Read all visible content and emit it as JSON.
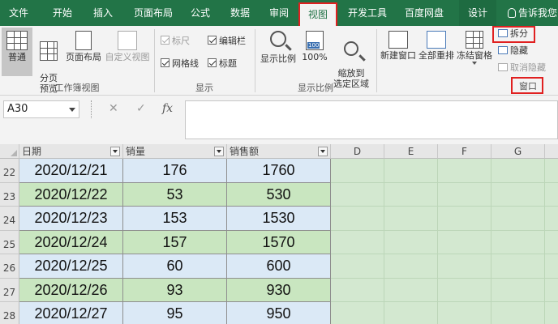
{
  "tabs": [
    "文件",
    "开始",
    "插入",
    "页面布局",
    "公式",
    "数据",
    "审阅",
    "视图",
    "开发工具",
    "百度网盘",
    "设计"
  ],
  "active_tab": "视图",
  "tell_me": "告诉我您",
  "ribbon": {
    "workbook_views": {
      "label": "工作簿视图",
      "buttons": [
        "普通",
        "分页\n预览",
        "页面布局",
        "自定义视图"
      ]
    },
    "show": {
      "label": "显示",
      "checkboxes": [
        {
          "label": "标尺",
          "checked": true,
          "disabled": true
        },
        {
          "label": "编辑栏",
          "checked": true,
          "disabled": false
        },
        {
          "label": "网格线",
          "checked": true,
          "disabled": false
        },
        {
          "label": "标题",
          "checked": true,
          "disabled": false
        }
      ]
    },
    "zoom": {
      "label": "显示比例",
      "buttons": [
        "显示比例",
        "100%",
        "缩放到\n选定区域"
      ],
      "badge": "100"
    },
    "window": {
      "label": "窗口",
      "buttons": [
        "新建窗口",
        "全部重排",
        "冻结窗格"
      ],
      "small": [
        "拆分",
        "隐藏",
        "取消隐藏"
      ]
    }
  },
  "formula_bar": {
    "name_box": "A30",
    "cancel": "✕",
    "enter": "✓",
    "fx": "fx",
    "value": ""
  },
  "grid": {
    "columns": [
      "日期",
      "销量",
      "销售额",
      "D",
      "E",
      "F",
      "G"
    ],
    "rows": [
      {
        "num": "22",
        "date": "2020/12/21",
        "qty": "176",
        "amt": "1760"
      },
      {
        "num": "23",
        "date": "2020/12/22",
        "qty": "53",
        "amt": "530"
      },
      {
        "num": "24",
        "date": "2020/12/23",
        "qty": "153",
        "amt": "1530"
      },
      {
        "num": "25",
        "date": "2020/12/24",
        "qty": "157",
        "amt": "1570"
      },
      {
        "num": "26",
        "date": "2020/12/25",
        "qty": "60",
        "amt": "600"
      },
      {
        "num": "27",
        "date": "2020/12/26",
        "qty": "93",
        "amt": "930"
      },
      {
        "num": "28",
        "date": "2020/12/27",
        "qty": "95",
        "amt": "950"
      }
    ]
  },
  "colors": {
    "excel_green": "#227447",
    "highlight_red": "#e02020"
  }
}
